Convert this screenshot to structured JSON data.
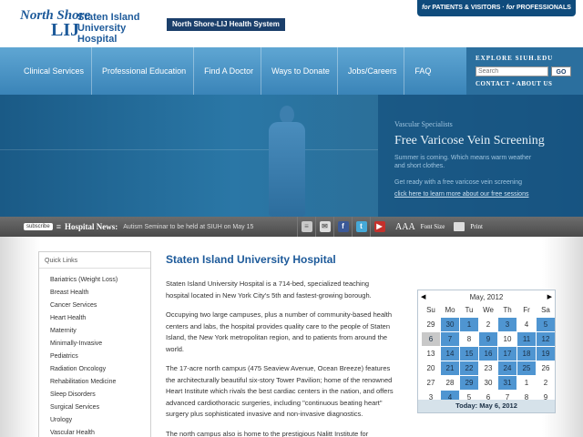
{
  "header": {
    "logo_north_shore": "North Shore",
    "logo_lij": "LIJ",
    "hospital_name_line1": "Staten Island",
    "hospital_name_line2": "University Hospital",
    "system_badge": "North Shore-LIJ Health System",
    "audience_for1": "for",
    "audience_link1": "PATIENTS & VISITORS",
    "audience_sep": " · ",
    "audience_for2": "for",
    "audience_link2": "PROFESSIONALS"
  },
  "nav": {
    "items": [
      "Clinical Services",
      "Professional Education",
      "Find A Doctor",
      "Ways to Donate",
      "Jobs/Careers",
      "FAQ"
    ]
  },
  "explore": {
    "title": "EXPLORE SIUH.EDU",
    "search_placeholder": "Search",
    "go_label": "GO",
    "links": "CONTACT • ABOUT US"
  },
  "promo": {
    "kicker": "Vascular Specialists",
    "headline": "Free Varicose Vein Screening",
    "blurb": "Summer is coming. Which means warm weather and short clothes.",
    "blurb2": "Get ready with a free varicose vein screening",
    "link": "click here to learn more about our free sessions"
  },
  "newsbar": {
    "subscribe": "subscribe",
    "label": "Hospital News:",
    "headline": "Autism Seminar to be held at SIUH on May 15",
    "font_size_glyph": "AAA",
    "font_size_label": "Font Size",
    "print_label": "Print",
    "icons": [
      "document-icon",
      "email-icon",
      "facebook-icon",
      "twitter-icon",
      "youtube-icon"
    ]
  },
  "quicklinks": {
    "title": "Quick Links",
    "items": [
      "Bariatrics (Weight Loss)",
      "Breast Health",
      "Cancer Services",
      "Heart Health",
      "Maternity",
      "Minimally-Invasive",
      "Pediatrics",
      "Radiation Oncology",
      "Rehabilitation Medicine",
      "Sleep Disorders",
      "Surgical Services",
      "Urology",
      "Vascular Health"
    ]
  },
  "main": {
    "title": "Staten Island University Hospital",
    "p1": "Staten Island University Hospital is a 714-bed, specialized teaching hospital located in New York City's 5th and fastest-growing borough.",
    "p2": "Occupying two large campuses, plus a number of community-based health centers and labs, the hospital provides quality care to the people of Staten Island, the New York metropolitan region, and to patients from around the world.",
    "p3": "The 17-acre north campus (475 Seaview Avenue, Ocean Breeze) features the architecturally beautiful six-story Tower Pavilion; home of the renowned Heart Institute which rivals the best cardiac centers in the nation, and offers advanced cardiothoracic surgeries, including \"continuous beating heart\" surgery plus sophisticated invasive and non-invasive diagnostics.",
    "p4": "The north campus also is home to the prestigious Nalitt Institute for"
  },
  "calendar": {
    "month": "May, 2012",
    "prev": "◀",
    "next": "▶",
    "dow": [
      "Su",
      "Mo",
      "Tu",
      "We",
      "Th",
      "Fr",
      "Sa"
    ],
    "weeks": [
      [
        {
          "d": "29",
          "e": false
        },
        {
          "d": "30",
          "e": true
        },
        {
          "d": "1",
          "e": true
        },
        {
          "d": "2",
          "e": false
        },
        {
          "d": "3",
          "e": true
        },
        {
          "d": "4",
          "e": false
        },
        {
          "d": "5",
          "e": true
        }
      ],
      [
        {
          "d": "6",
          "e": true
        },
        {
          "d": "7",
          "e": true
        },
        {
          "d": "8",
          "e": false
        },
        {
          "d": "9",
          "e": true
        },
        {
          "d": "10",
          "e": false
        },
        {
          "d": "11",
          "e": true
        },
        {
          "d": "12",
          "e": true
        }
      ],
      [
        {
          "d": "13",
          "e": false
        },
        {
          "d": "14",
          "e": true
        },
        {
          "d": "15",
          "e": true
        },
        {
          "d": "16",
          "e": true
        },
        {
          "d": "17",
          "e": true
        },
        {
          "d": "18",
          "e": true
        },
        {
          "d": "19",
          "e": true
        }
      ],
      [
        {
          "d": "20",
          "e": false
        },
        {
          "d": "21",
          "e": true
        },
        {
          "d": "22",
          "e": true
        },
        {
          "d": "23",
          "e": false
        },
        {
          "d": "24",
          "e": true
        },
        {
          "d": "25",
          "e": true
        },
        {
          "d": "26",
          "e": false
        }
      ],
      [
        {
          "d": "27",
          "e": false
        },
        {
          "d": "28",
          "e": false
        },
        {
          "d": "29",
          "e": true
        },
        {
          "d": "30",
          "e": false
        },
        {
          "d": "31",
          "e": true
        },
        {
          "d": "1",
          "e": false
        },
        {
          "d": "2",
          "e": false
        }
      ],
      [
        {
          "d": "3",
          "e": false
        },
        {
          "d": "4",
          "e": true
        },
        {
          "d": "5",
          "e": false
        },
        {
          "d": "6",
          "e": false
        },
        {
          "d": "7",
          "e": false
        },
        {
          "d": "8",
          "e": false
        },
        {
          "d": "9",
          "e": false
        }
      ]
    ],
    "today_label": "Today: May 6, 2012"
  }
}
